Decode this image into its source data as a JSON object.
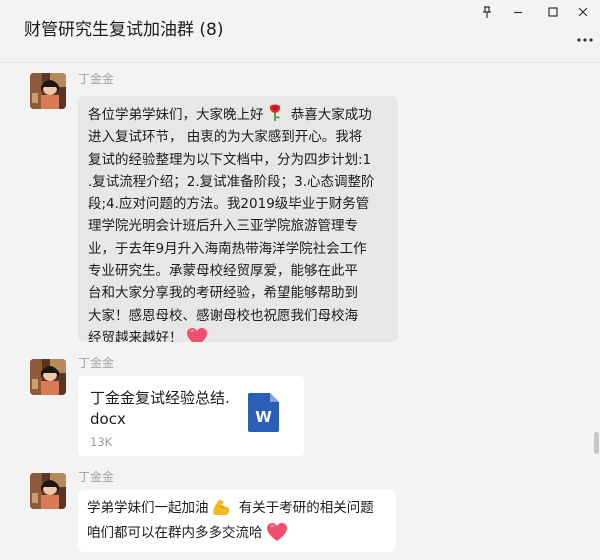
{
  "window": {
    "title": "财管研究生复试加油群 (8)",
    "buttons": [
      "pin",
      "minimize",
      "maximize",
      "close"
    ],
    "more_label": "···"
  },
  "messages": [
    {
      "sender": "丁金金",
      "type": "text",
      "lines": [
        "各位学弟学妹们，大家晚上好",
        " 恭喜大家成功",
        "进入复试环节， 由衷的为大家感到开心。我将",
        "复试的经验整理为以下文档中，分为四步计划:1",
        ".复试流程介绍；2.复试准备阶段；3.心态调整阶",
        "段;4.应对问题的方法。我2019级毕业于财务管",
        "理学院光明会计班后升入三亚学院旅游管理专",
        "业，于去年9月升入海南热带海洋学院社会工作",
        "专业研究生。承蒙母校经贸厚爱，能够在此平",
        "台和大家分享我的考研经验，希望能够帮助到",
        "大家！感恩母校、感谢母校也祝愿我们母校海",
        "经贸越来越好！"
      ],
      "emojis": [
        "rose",
        "heart"
      ]
    },
    {
      "sender": "丁金金",
      "type": "file",
      "file": {
        "name_lines": [
          "丁金金复试经验总结.",
          "docx"
        ],
        "size": "13K",
        "icon": "word-file-icon",
        "icon_letter": "W",
        "icon_color": "#2b5fb7"
      }
    },
    {
      "sender": "丁金金",
      "type": "text",
      "lines": [
        "学弟学妹们一起加油",
        " 有关于考研的相关问题",
        "咱们都可以在群内多多交流哈"
      ],
      "emojis": [
        "flexed-biceps",
        "heart"
      ]
    }
  ],
  "colors": {
    "background": "#f3f3f3",
    "bubble_gray": "#e7e7e7",
    "bubble_white": "#ffffff",
    "sender_gray": "#a3a3a3"
  }
}
